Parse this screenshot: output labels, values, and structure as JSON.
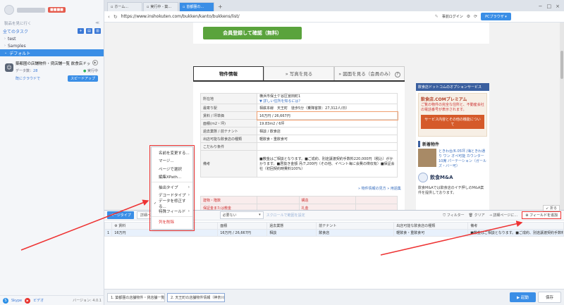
{
  "sidebar": {
    "search_label": "製品を見に行く",
    "plan_badge": "■■■■",
    "all_tasks": "全てのタスク",
    "tree": [
      {
        "label": "test"
      },
      {
        "label": "Samples"
      },
      {
        "label": "デフォルト"
      }
    ],
    "task": {
      "title": "築都圏の店舗物件・貸店舗一覧 飲食店ドッ",
      "data_label": "データ数：",
      "data_count": "28",
      "status": "実行中",
      "cloud_label": "既にクラウドで",
      "speed_label": "スピードアップ"
    },
    "footer": {
      "skype": "Skype",
      "video": "ビデオ",
      "version": "バージョン: 4.0.1"
    }
  },
  "browser": {
    "tabs": [
      {
        "label": "ホーム..."
      },
      {
        "label": "実行中 - 築..."
      },
      {
        "label": "首都圏の..."
      }
    ],
    "url": "https://www.inshokuten.com/bukken/kanto/bukkens/list/",
    "prev_login": "事前ログイン",
    "pc_browser": "PCブラウザ"
  },
  "webpage": {
    "register_button": "会員登録して確認（無料）",
    "tabs": [
      {
        "label": "物件情報"
      },
      {
        "label": "» 写真を見る"
      },
      {
        "label": "» 図面を見る（会員のみ）"
      }
    ],
    "rows": [
      {
        "k": "所在地",
        "v": "横浜市保土ケ谷区宮田町1",
        "v2": "▼ 詳しい住所を知るには？"
      },
      {
        "k": "最寄り駅",
        "v": "相鉄本線　天王町　徒歩5分（乗降客数：27,312人/日）"
      },
      {
        "k": "賃料 / 坪単価",
        "v": "16万円 / 26,667円"
      },
      {
        "k": "面積(m2・坪)",
        "v": "19.83m2 / 6坪"
      },
      {
        "k": "過去業態 / 前テナント",
        "v": "相談 / 飲食店"
      },
      {
        "k": "出店可能な飲食店の種類",
        "v": "軽飲食・重飲食可"
      },
      {
        "k": "こだわり条件",
        "v": ""
      },
      {
        "k": "備考",
        "v": "■敷金はご相談となります。■ご成約、別途譲渡契約手数料220,000円（税込）がかかります。■居抜き金額 月/7,200円（その他、イベント毎に会費の徴収有）■保証会社（初回契約時費料100%）"
      }
    ],
    "links": "» 物件情報の見方 » 用語集",
    "bottom_rows": [
      {
        "k": "建物・階数",
        "v": "構造"
      },
      {
        "k": "保証金または敷金",
        "v": "礼金"
      }
    ],
    "right": {
      "head": "飲食店ドットコムのオプションサービス",
      "promo_title": "飲食店.COMプレミアム",
      "promo_text": "ご覧の物件の完全な住所と、不動産会社の電話番号が表示されます。",
      "promo_btn": "サービス内容とその他の機能について",
      "recent": "新着物件",
      "recent_item": "ときわ台/6.05坪 /海ときわ通り ワン オペ可能 カウンター 10席 パーテーション（ガールズ・バー可）",
      "logo": "飲食M&A",
      "logo_text": "飲食M&Aでは飲食店のイチ押しのM&A案件を提供しております。"
    }
  },
  "context_menu": {
    "items": [
      {
        "label": "名前を変更する..."
      },
      {
        "label": "マージ..."
      },
      {
        "label": "ページで選択"
      },
      {
        "label": "編集XPath..."
      },
      {
        "label": "抽出タイプ"
      },
      {
        "label": "デコードタイプ"
      },
      {
        "label": "データを修正する..."
      },
      {
        "label": "特殊フィールド"
      },
      {
        "label": "列を削除"
      }
    ]
  },
  "panel": {
    "fold": "折る",
    "page_type": "ページタイプ",
    "detail": "詳細ペ...",
    "select_value": "必要ない",
    "scroll_settings": "スクロールで範囲を設定",
    "filter": "フィルター",
    "clear": "クリア",
    "detail_page_action": "詳細ページに…",
    "add_field": "フィールドを追加",
    "columns": [
      "",
      "賃料",
      "面積",
      "過去業態",
      "前テナント",
      "出店可能な飲食店の種類",
      "備考"
    ],
    "rows": [
      [
        "1",
        "16万円",
        "16万円 / 26,667円",
        "相談",
        "飲食店",
        "軽飲食・重飲食可",
        "■敷金はご相談となります。■ご成約、別途譲渡契約手数料220..."
      ]
    ]
  },
  "bottombar": {
    "tabs": [
      {
        "label": "1. 築都圏の店舗物件・貸店舗一覧..."
      },
      {
        "label": "2. 天王町の店舗物件情報（神奈川..."
      }
    ],
    "start": "▶ 起動",
    "save": "保存"
  }
}
